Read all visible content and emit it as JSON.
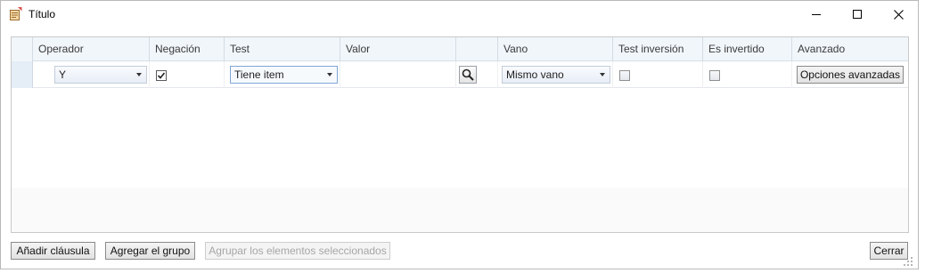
{
  "window": {
    "title": "Título",
    "icon": "app-document-icon",
    "controls": [
      "minimize-icon",
      "maximize-icon",
      "close-icon"
    ]
  },
  "grid": {
    "columns": [
      {
        "label": "Operador"
      },
      {
        "label": "Negación"
      },
      {
        "label": "Test"
      },
      {
        "label": "Valor"
      },
      {
        "label": ""
      },
      {
        "label": "Vano"
      },
      {
        "label": "Test inversión"
      },
      {
        "label": "Es invertido"
      },
      {
        "label": "Avanzado"
      }
    ],
    "rows": [
      {
        "operador": "Y",
        "negacion_checked": true,
        "test": "Tiene item",
        "valor": "",
        "search_icon": "magnifier-icon",
        "vano": "Mismo vano",
        "test_inversion_checked": false,
        "es_invertido_checked": false,
        "avanzado_label": "Opciones avanzadas"
      }
    ]
  },
  "footer": {
    "add_clause": "Añadir cláusula",
    "add_group": "Agregar el grupo",
    "group_selected": "Agrupar los elementos seleccionados",
    "group_selected_enabled": false,
    "close": "Cerrar"
  },
  "colors": {
    "header_bg": "#f1f6fb",
    "focus_border": "#7ea6d6",
    "disabled_text": "#a6a6a6"
  }
}
